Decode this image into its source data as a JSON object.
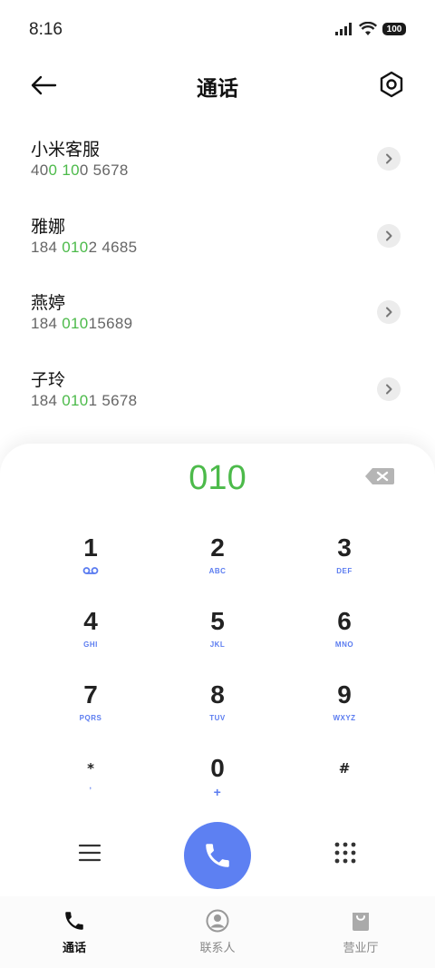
{
  "status": {
    "time": "8:16",
    "battery": "100"
  },
  "header": {
    "title": "通话"
  },
  "contacts": [
    {
      "name": "小米客服",
      "number_parts": [
        {
          "text": "40",
          "hl": false
        },
        {
          "text": "0",
          "hl": true
        },
        {
          "text": " ",
          "hl": false
        },
        {
          "text": "10",
          "hl": true
        },
        {
          "text": "0 5678",
          "hl": false
        }
      ]
    },
    {
      "name": "雅娜",
      "number_parts": [
        {
          "text": "184 ",
          "hl": false
        },
        {
          "text": "010",
          "hl": true
        },
        {
          "text": "2 4685",
          "hl": false
        }
      ]
    },
    {
      "name": "燕婷",
      "number_parts": [
        {
          "text": "184 ",
          "hl": false
        },
        {
          "text": "010",
          "hl": true
        },
        {
          "text": "15689",
          "hl": false
        }
      ]
    },
    {
      "name": "子玲",
      "number_parts": [
        {
          "text": "184 ",
          "hl": false
        },
        {
          "text": "010",
          "hl": true
        },
        {
          "text": "1 5678",
          "hl": false
        }
      ]
    }
  ],
  "dialed": "010",
  "keypad": [
    {
      "digit": "1",
      "sub": ""
    },
    {
      "digit": "2",
      "sub": "ABC"
    },
    {
      "digit": "3",
      "sub": "DEF"
    },
    {
      "digit": "4",
      "sub": "GHI"
    },
    {
      "digit": "5",
      "sub": "JKL"
    },
    {
      "digit": "6",
      "sub": "MNO"
    },
    {
      "digit": "7",
      "sub": "PQRS"
    },
    {
      "digit": "8",
      "sub": "TUV"
    },
    {
      "digit": "9",
      "sub": "WXYZ"
    },
    {
      "digit": "*",
      "sub": ","
    },
    {
      "digit": "0",
      "sub": "+"
    },
    {
      "digit": "#",
      "sub": ""
    }
  ],
  "nav": [
    {
      "label": "通话",
      "icon": "phone-icon",
      "active": true
    },
    {
      "label": "联系人",
      "icon": "contact-icon",
      "active": false
    },
    {
      "label": "营业厅",
      "icon": "store-bag-icon",
      "active": false
    }
  ],
  "colors": {
    "accent": "#5d80f2",
    "match": "#4cba4a"
  }
}
